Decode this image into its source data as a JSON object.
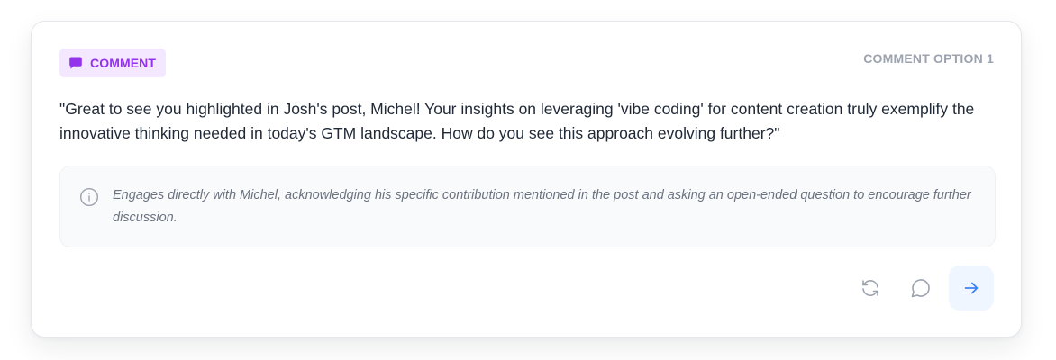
{
  "badge": {
    "label": "COMMENT",
    "icon": "message-square-icon",
    "color": "#9333ea",
    "background": "#f3e8ff"
  },
  "option_label": "COMMENT OPTION 1",
  "comment": {
    "text": "\"Great to see you highlighted in Josh's post, Michel! Your insights on leveraging 'vibe coding' for content creation truly exemplify the innovative thinking needed in today's GTM landscape. How do you see this approach evolving further?\""
  },
  "reasoning": {
    "icon": "info-icon",
    "text": "Engages directly with Michel, acknowledging his specific contribution mentioned in the post and asking an open-ended question to encourage further discussion."
  },
  "actions": [
    {
      "icon": "refresh-icon",
      "name": "regenerate-button"
    },
    {
      "icon": "chat-bubble-icon",
      "name": "comment-button"
    },
    {
      "icon": "arrow-right-icon",
      "name": "send-button",
      "accent": "#3b82f6"
    }
  ]
}
